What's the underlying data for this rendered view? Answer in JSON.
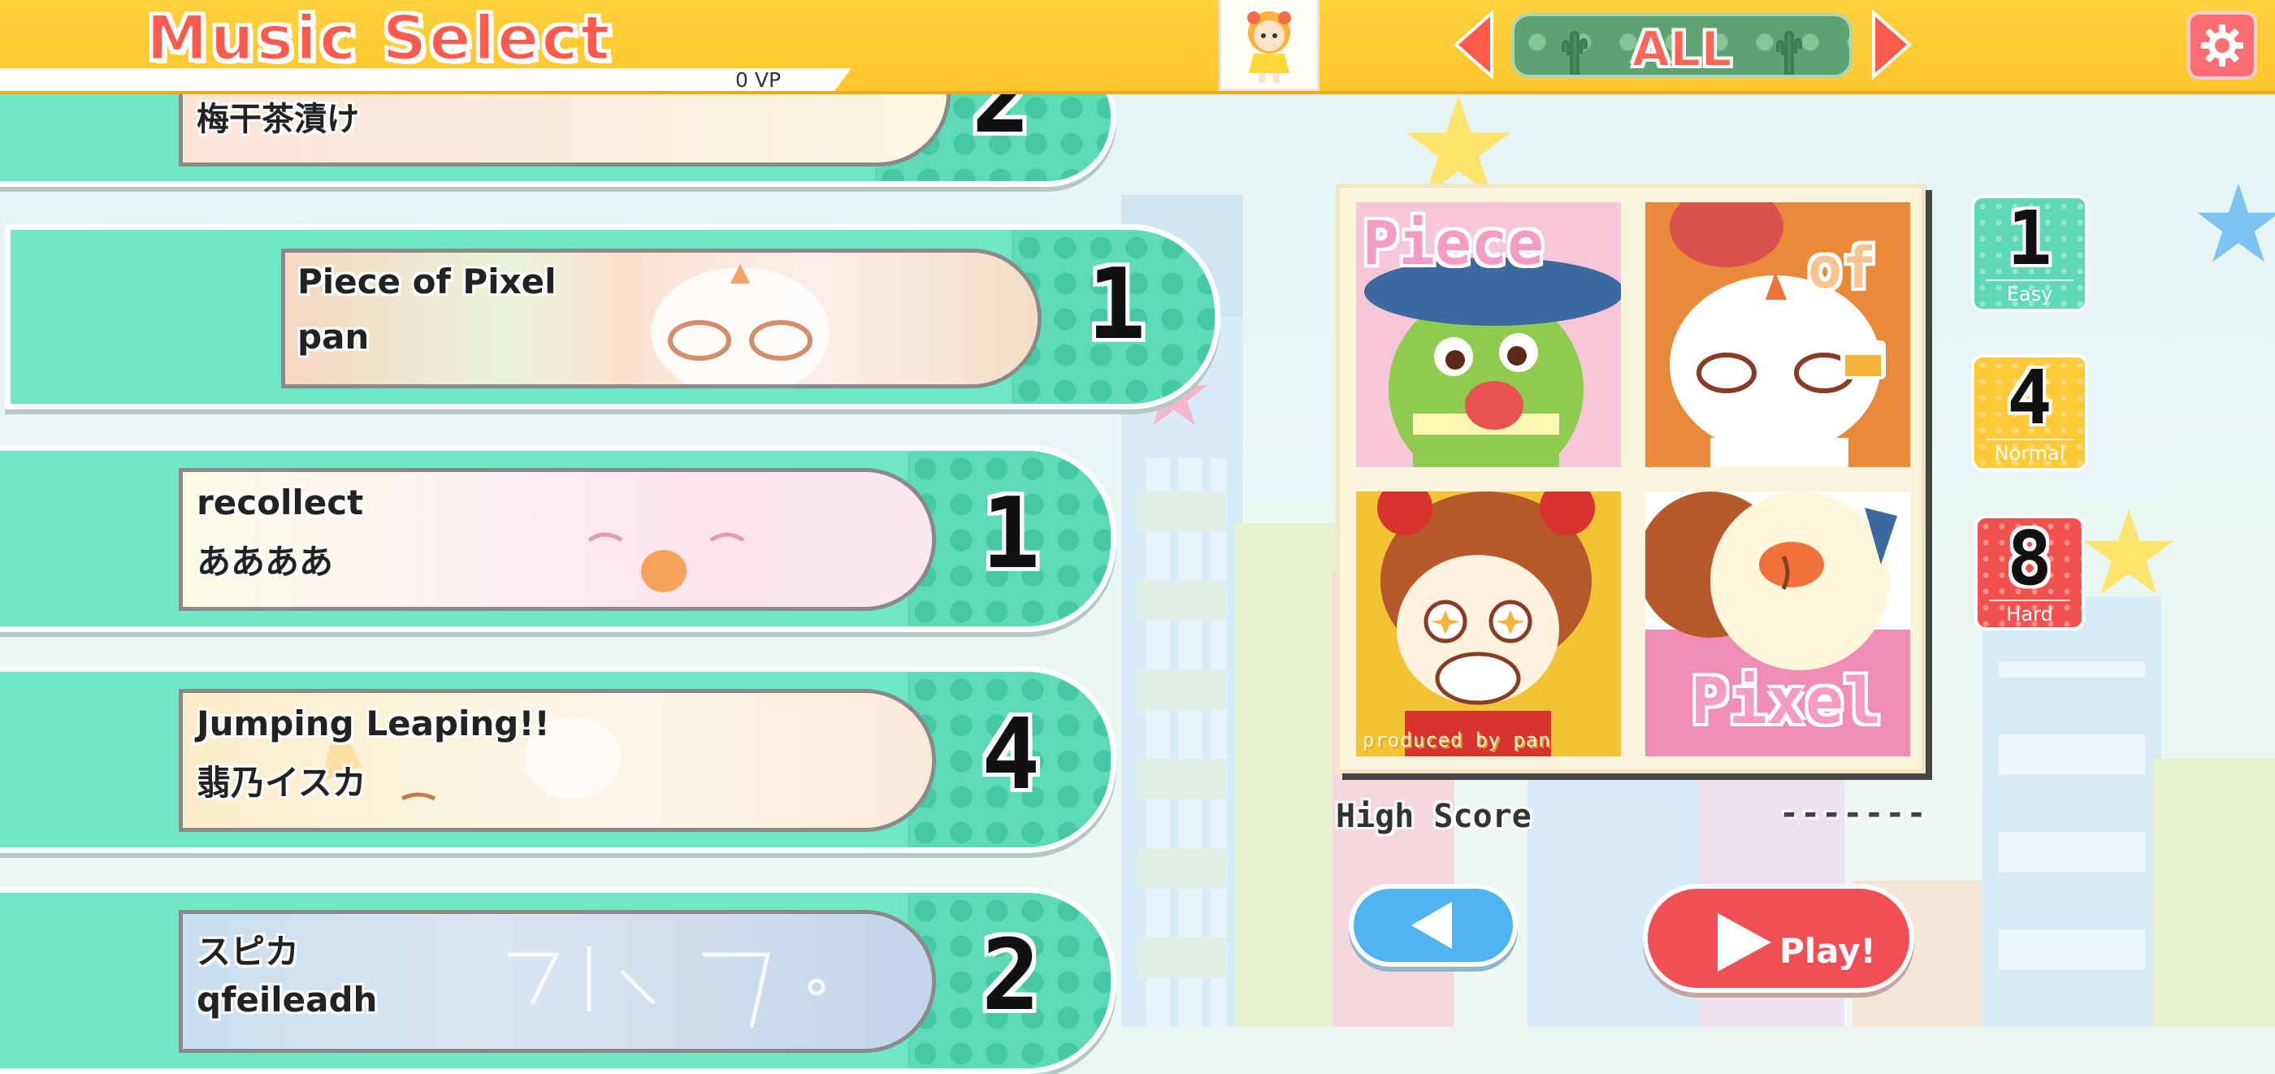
{
  "header": {
    "title": "Music Select",
    "vp": "0 VP",
    "filter_label": "ALL"
  },
  "songs": [
    {
      "title": "梅干茶漬け",
      "artist": "",
      "level": "2",
      "selected": false
    },
    {
      "title": "Piece of Pixel",
      "artist": "pan",
      "level": "1",
      "selected": true
    },
    {
      "title": "recollect",
      "artist": "ああああ",
      "level": "1",
      "selected": false
    },
    {
      "title": "Jumping Leaping!!",
      "artist": "翡乃イスカ",
      "level": "4",
      "selected": false
    },
    {
      "title": "スピカ",
      "artist": "qfeileadh",
      "level": "2",
      "selected": false
    }
  ],
  "jacket": {
    "top_left_text": "Piece",
    "top_right_text": "of",
    "bottom_right_text": "Pixel",
    "credit": "produced by pan"
  },
  "high_score": {
    "label": "High Score",
    "value": "-------"
  },
  "difficulties": [
    {
      "level": "1",
      "name": "Easy",
      "color": "#5fd9b4"
    },
    {
      "level": "4",
      "name": "Normal",
      "color": "#ffc938"
    },
    {
      "level": "8",
      "name": "Hard",
      "color": "#f2524f"
    }
  ],
  "buttons": {
    "play_label": "Play!"
  },
  "colors": {
    "topbar": "#ffc62c",
    "title": "#ff5a4e",
    "song_pill": "#6ee8c4",
    "play": "#f04f55",
    "back": "#4fb4f0"
  }
}
